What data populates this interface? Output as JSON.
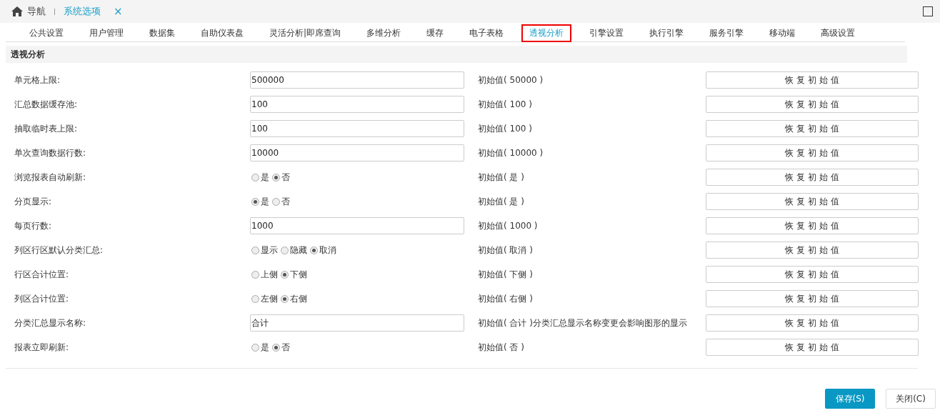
{
  "breadcrumb": {
    "home": "导航",
    "current": "系统选项",
    "close": "×"
  },
  "tabs": [
    {
      "label": "公共设置",
      "selected": false
    },
    {
      "label": "用户管理",
      "selected": false
    },
    {
      "label": "数据集",
      "selected": false
    },
    {
      "label": "自助仪表盘",
      "selected": false
    },
    {
      "label": "灵活分析|即席查询",
      "selected": false
    },
    {
      "label": "多维分析",
      "selected": false
    },
    {
      "label": "缓存",
      "selected": false
    },
    {
      "label": "电子表格",
      "selected": false
    },
    {
      "label": "透视分析",
      "selected": true
    },
    {
      "label": "引擎设置",
      "selected": false
    },
    {
      "label": "执行引擎",
      "selected": false
    },
    {
      "label": "服务引擎",
      "selected": false
    },
    {
      "label": "移动端",
      "selected": false
    },
    {
      "label": "高级设置",
      "selected": false
    }
  ],
  "section_title": "透视分析",
  "settings": [
    {
      "label": "单元格上限:",
      "kind": "input",
      "value": "500000",
      "initial": "初始值( 50000 )",
      "reset": "恢 复 初 始 值"
    },
    {
      "label": "汇总数据缓存池:",
      "kind": "input",
      "value": "100",
      "initial": "初始值( 100 )",
      "reset": "恢 复 初 始 值"
    },
    {
      "label": "抽取临时表上限:",
      "kind": "input",
      "value": "100",
      "initial": "初始值( 100 )",
      "reset": "恢 复 初 始 值"
    },
    {
      "label": "单次查询数据行数:",
      "kind": "input",
      "value": "10000",
      "initial": "初始值( 10000 )",
      "reset": "恢 复 初 始 值"
    },
    {
      "label": "浏览报表自动刷新:",
      "kind": "radio",
      "options": [
        {
          "label": "是",
          "selected": false
        },
        {
          "label": "否",
          "selected": true
        }
      ],
      "initial": "初始值( 是 )",
      "reset": "恢 复 初 始 值"
    },
    {
      "label": "分页显示:",
      "kind": "radio",
      "options": [
        {
          "label": "是",
          "selected": true
        },
        {
          "label": "否",
          "selected": false
        }
      ],
      "initial": "初始值( 是 )",
      "reset": "恢 复 初 始 值"
    },
    {
      "label": "每页行数:",
      "kind": "input",
      "value": "1000",
      "initial": "初始值( 1000 )",
      "reset": "恢 复 初 始 值"
    },
    {
      "label": "列区行区默认分类汇总:",
      "kind": "radio",
      "options": [
        {
          "label": "显示",
          "selected": false
        },
        {
          "label": "隐藏",
          "selected": false
        },
        {
          "label": "取消",
          "selected": true
        }
      ],
      "initial": "初始值( 取消 )",
      "reset": "恢 复 初 始 值"
    },
    {
      "label": "行区合计位置:",
      "kind": "radio",
      "options": [
        {
          "label": "上侧",
          "selected": false
        },
        {
          "label": "下侧",
          "selected": true
        }
      ],
      "initial": "初始值( 下侧 )",
      "reset": "恢 复 初 始 值"
    },
    {
      "label": "列区合计位置:",
      "kind": "radio",
      "options": [
        {
          "label": "左侧",
          "selected": false
        },
        {
          "label": "右侧",
          "selected": true
        }
      ],
      "initial": "初始值( 右侧 )",
      "reset": "恢 复 初 始 值"
    },
    {
      "label": "分类汇总显示名称:",
      "kind": "input",
      "value": "合计",
      "initial": "初始值( 合计 )分类汇总显示名称变更会影响图形的显示",
      "reset": "恢 复 初 始 值"
    },
    {
      "label": "报表立即刷新:",
      "kind": "radio",
      "options": [
        {
          "label": "是",
          "selected": false
        },
        {
          "label": "否",
          "selected": true
        }
      ],
      "initial": "初始值( 否 )",
      "reset": "恢 复 初 始 值"
    }
  ],
  "buttons": [
    {
      "label": "保存(S)",
      "kind": "primary"
    },
    {
      "label": "关闭(C)",
      "kind": "secondary"
    }
  ]
}
